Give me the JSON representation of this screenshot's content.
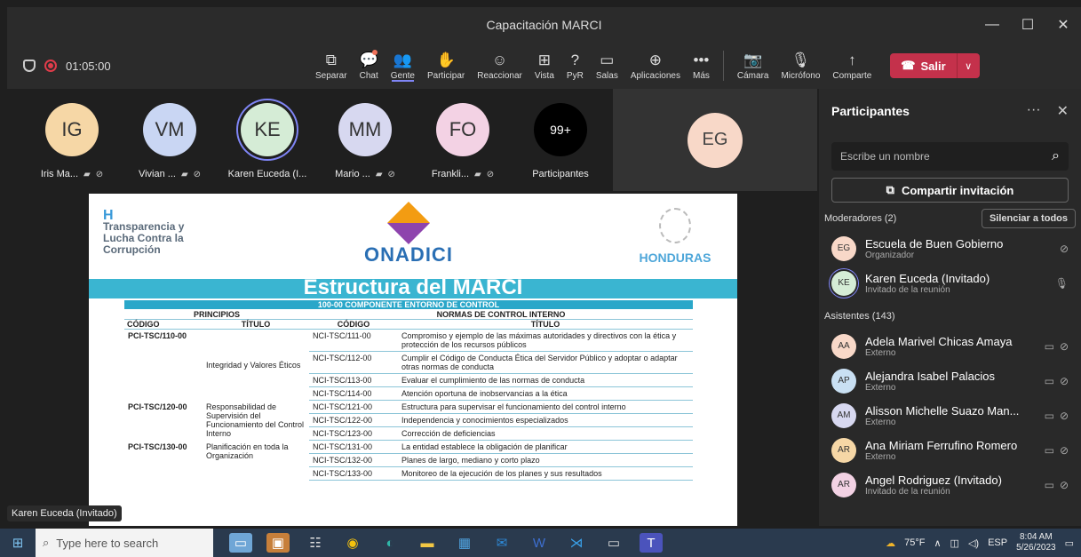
{
  "window": {
    "title": "Capacitación MARCI",
    "controls": [
      "—",
      "☐",
      "✕"
    ]
  },
  "toolbar": {
    "timer": "01:05:00",
    "buttons": [
      {
        "label": "Separar",
        "icon": "⧉"
      },
      {
        "label": "Chat",
        "icon": "💬"
      },
      {
        "label": "Gente",
        "icon": "👥"
      },
      {
        "label": "Participar",
        "icon": "✋"
      },
      {
        "label": "Reaccionar",
        "icon": "☺"
      },
      {
        "label": "Vista",
        "icon": "⊞"
      },
      {
        "label": "PyR",
        "icon": "?"
      },
      {
        "label": "Salas",
        "icon": "▭"
      },
      {
        "label": "Aplicaciones",
        "icon": "⊕"
      },
      {
        "label": "Más",
        "icon": "•••"
      },
      {
        "label": "Cámara",
        "icon": "📷"
      },
      {
        "label": "Micrófono",
        "icon": "🎙"
      },
      {
        "label": "Comparte",
        "icon": "↑"
      }
    ],
    "leave_label": "Salir"
  },
  "strip": {
    "people": [
      {
        "initials": "IG",
        "name": "Iris Ma...",
        "color": "#f6d7a6"
      },
      {
        "initials": "VM",
        "name": "Vivian ...",
        "color": "#c9d6f3"
      },
      {
        "initials": "KE",
        "name": "Karen Euceda (I...",
        "color": "#d5ecd6"
      },
      {
        "initials": "MM",
        "name": "Mario ...",
        "color": "#d7d8f0"
      },
      {
        "initials": "FO",
        "name": "Frankli...",
        "color": "#f3d2e4"
      },
      {
        "initials": "99+",
        "name": "Participantes",
        "color": "#000000"
      }
    ],
    "featured_initials": "EG"
  },
  "slide": {
    "org_logo_lines": [
      "Transparencia y",
      "Lucha Contra la",
      "Corrupción"
    ],
    "org_logo_mark": "H",
    "center_logo": "ONADICI",
    "right_logo": "HONDURAS",
    "title": "Estructura del MARCI",
    "component": "100-00 COMPONENTE ENTORNO DE CONTROL",
    "headers": {
      "principios": "PRINCIPIOS",
      "normas": "NORMAS DE CONTROL INTERNO",
      "codigo": "CÓDIGO",
      "titulo": "TÍTULO"
    },
    "groups": [
      {
        "code": "PCI-TSC/110-00",
        "title": "Integridad y Valores Éticos",
        "norms": [
          {
            "code": "NCI-TSC/111-00",
            "title": "Compromiso y ejemplo de las máximas autoridades y directivos con la ética y protección de los recursos públicos"
          },
          {
            "code": "NCI-TSC/112-00",
            "title": "Cumplir el Código de Conducta Ética del Servidor Público y adoptar o adaptar otras normas de conducta"
          },
          {
            "code": "NCI-TSC/113-00",
            "title": "Evaluar el cumplimiento de las normas de conducta"
          },
          {
            "code": "NCI-TSC/114-00",
            "title": "Atención oportuna de inobservancias a la ética"
          }
        ]
      },
      {
        "code": "PCI-TSC/120-00",
        "title": "Responsabilidad de Supervisión del Funcionamiento del Control Interno",
        "norms": [
          {
            "code": "NCI-TSC/121-00",
            "title": "Estructura para supervisar el funcionamiento del control interno"
          },
          {
            "code": "NCI-TSC/122-00",
            "title": "Independencia y conocimientos especializados"
          },
          {
            "code": "NCI-TSC/123-00",
            "title": "Corrección de deficiencias"
          }
        ]
      },
      {
        "code": "PCI-TSC/130-00",
        "title": "Planificación en toda la Organización",
        "norms": [
          {
            "code": "NCI-TSC/131-00",
            "title": "La entidad establece la obligación de planificar"
          },
          {
            "code": "NCI-TSC/132-00",
            "title": "Planes de largo, mediano y corto plazo"
          },
          {
            "code": "NCI-TSC/133-00",
            "title": "Monitoreo de la ejecución de los planes y sus resultados"
          }
        ]
      }
    ]
  },
  "presenter_caption": "Karen Euceda (Invitado)",
  "panel": {
    "title": "Participantes",
    "search_placeholder": "Escribe un nombre",
    "share_label": "Compartir invitación",
    "moderators_label": "Moderadores (2)",
    "mute_all_label": "Silenciar a todos",
    "moderators": [
      {
        "initials": "EG",
        "name": "Escuela de Buen Gobierno",
        "role": "Organizador",
        "color": "#f8d8c8"
      },
      {
        "initials": "KE",
        "name": "Karen Euceda (Invitado)",
        "role": "Invitado de la reunión",
        "color": "#d5ecd6"
      }
    ],
    "attendees_label": "Asistentes (143)",
    "attendees": [
      {
        "initials": "AA",
        "name": "Adela Marivel Chicas Amaya",
        "role": "Externo",
        "color": "#f8d8c8"
      },
      {
        "initials": "AP",
        "name": "Alejandra Isabel Palacios",
        "role": "Externo",
        "color": "#c9e0f3"
      },
      {
        "initials": "AM",
        "name": "Alisson Michelle Suazo Man...",
        "role": "Externo",
        "color": "#d7d8f0"
      },
      {
        "initials": "AR",
        "name": "Ana Miriam Ferrufino Romero",
        "role": "Externo",
        "color": "#f6d7a6"
      },
      {
        "initials": "AR",
        "name": "Angel Rodriguez (Invitado)",
        "role": "Invitado de la reunión",
        "color": "#f3d2e4"
      }
    ]
  },
  "taskbar": {
    "search_placeholder": "Type here to search",
    "weather": "75°F",
    "lang": "ESP",
    "time": "8:04 AM",
    "date": "5/26/2023"
  }
}
